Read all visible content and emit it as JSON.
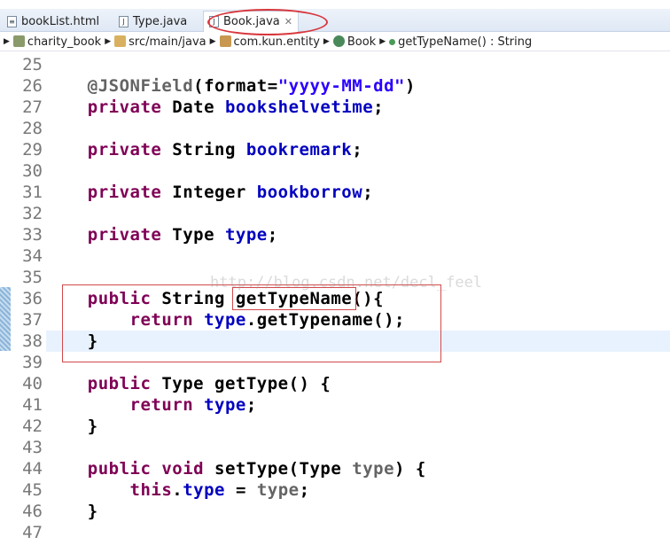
{
  "tabs": [
    {
      "label": "bookList.html",
      "icon": "html-file-icon"
    },
    {
      "label": "Type.java",
      "icon": "java-file-icon"
    },
    {
      "label": "Book.java",
      "icon": "java-file-icon",
      "active": true
    }
  ],
  "breadcrumb": [
    "charity_book",
    "src/main/java",
    "com.kun.entity",
    "Book",
    "getTypeName() : String"
  ],
  "watermark": "http://blog.csdn.net/decl_feel",
  "colors": {
    "keyword": "#7f0055",
    "field": "#0000c0",
    "annotation": "#646464",
    "string": "#2a00ff",
    "highlight": "#d24a4a"
  },
  "lines": [
    {
      "n": "25",
      "t": []
    },
    {
      "n": "26",
      "t": [
        [
          "ann",
          "    @JSONField"
        ],
        [
          "",
          "("
        ],
        [
          "",
          "format="
        ],
        [
          "str",
          "\"yyyy-MM-dd\""
        ],
        [
          "",
          ")"
        ]
      ]
    },
    {
      "n": "27",
      "t": [
        [
          "kw",
          "    private"
        ],
        [
          "",
          " Date "
        ],
        [
          "fld",
          "bookshelvetime"
        ],
        [
          "",
          ";"
        ]
      ]
    },
    {
      "n": "28",
      "t": []
    },
    {
      "n": "29",
      "t": [
        [
          "kw",
          "    private"
        ],
        [
          "",
          " String "
        ],
        [
          "fld",
          "bookremark"
        ],
        [
          "",
          ";"
        ]
      ]
    },
    {
      "n": "30",
      "t": []
    },
    {
      "n": "31",
      "t": [
        [
          "kw",
          "    private"
        ],
        [
          "",
          " Integer "
        ],
        [
          "fld",
          "bookborrow"
        ],
        [
          "",
          ";"
        ]
      ]
    },
    {
      "n": "32",
      "t": []
    },
    {
      "n": "33",
      "t": [
        [
          "kw",
          "    private"
        ],
        [
          "",
          " Type "
        ],
        [
          "fld",
          "type"
        ],
        [
          "",
          ";"
        ]
      ]
    },
    {
      "n": "34",
      "t": []
    },
    {
      "n": "35",
      "t": []
    },
    {
      "n": "36",
      "t": [
        [
          "kw",
          "    public"
        ],
        [
          "",
          " String getTypeName(){"
        ]
      ]
    },
    {
      "n": "37",
      "t": [
        [
          "kw",
          "        return"
        ],
        [
          "fld",
          " type"
        ],
        [
          "",
          ".getTypename();"
        ]
      ]
    },
    {
      "n": "38",
      "t": [
        [
          "",
          "    }"
        ]
      ],
      "current": true
    },
    {
      "n": "39",
      "t": []
    },
    {
      "n": "40",
      "t": [
        [
          "kw",
          "    public"
        ],
        [
          "",
          " Type getType() {"
        ]
      ]
    },
    {
      "n": "41",
      "t": [
        [
          "kw",
          "        return"
        ],
        [
          "fld",
          " type"
        ],
        [
          "",
          ";"
        ]
      ]
    },
    {
      "n": "42",
      "t": [
        [
          "",
          "    }"
        ]
      ]
    },
    {
      "n": "43",
      "t": []
    },
    {
      "n": "44",
      "t": [
        [
          "kw",
          "    public"
        ],
        [
          "kw",
          " void"
        ],
        [
          "",
          " setType(Type "
        ],
        [
          "ann",
          "type"
        ],
        [
          "",
          ") {"
        ]
      ]
    },
    {
      "n": "45",
      "t": [
        [
          "kw",
          "        this"
        ],
        [
          "",
          ".",
          ""
        ],
        [
          "fld",
          "type"
        ],
        [
          "",
          " = "
        ],
        [
          "ann",
          "type"
        ],
        [
          "",
          ";"
        ]
      ]
    },
    {
      "n": "46",
      "t": [
        [
          "",
          "    }"
        ]
      ]
    },
    {
      "n": "47",
      "t": []
    }
  ]
}
